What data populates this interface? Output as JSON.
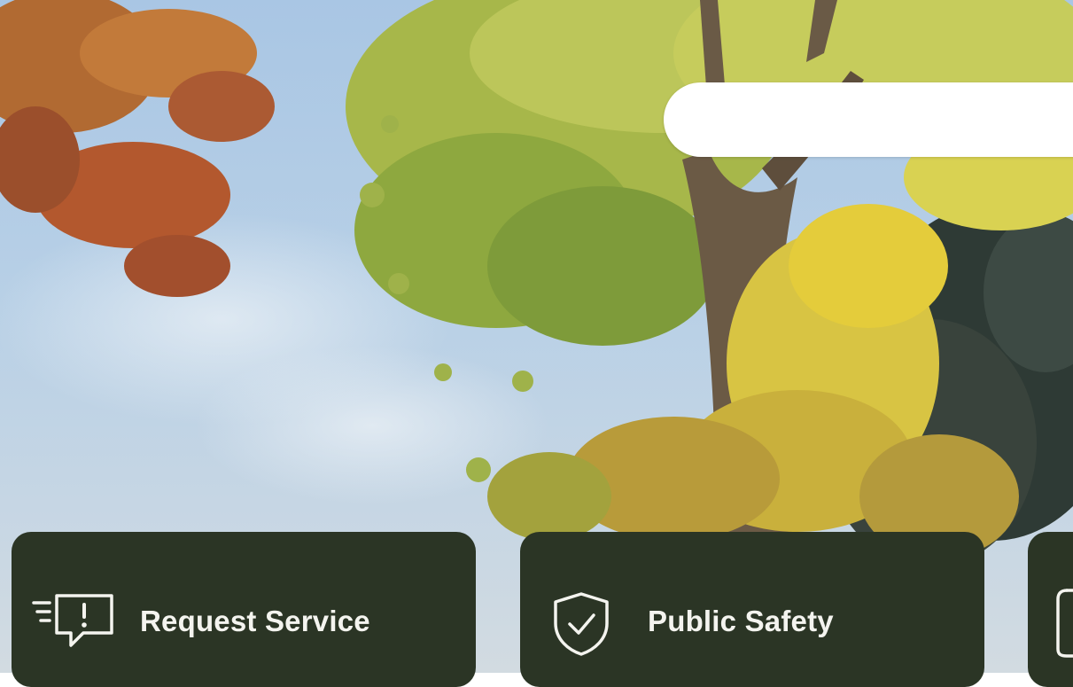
{
  "search": {
    "placeholder": ""
  },
  "quick_links": [
    {
      "label": "Request Service",
      "icon": "request-service-icon"
    },
    {
      "label": "Public Safety",
      "icon": "shield-check-icon"
    },
    {
      "label": "",
      "icon": "document-icon"
    }
  ],
  "colors": {
    "card_bg": "#2b3525",
    "card_text": "#f4f4ef",
    "sky": "#b8d0e6"
  }
}
